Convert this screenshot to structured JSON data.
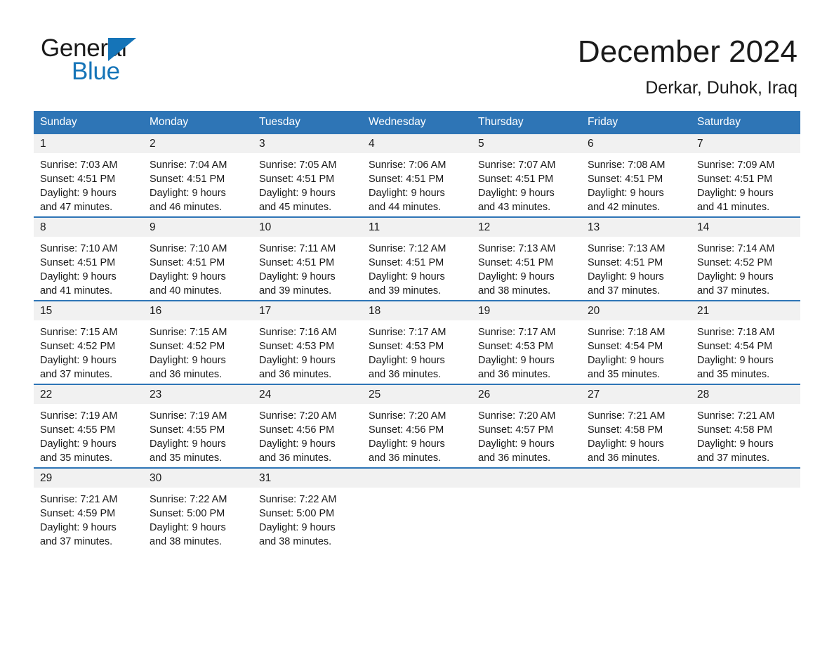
{
  "brand": {
    "name_part1": "General",
    "name_part2": "Blue",
    "logo_icon": "triangle-flag-icon",
    "color_primary": "#1574b8"
  },
  "header": {
    "month_title": "December 2024",
    "location": "Derkar, Duhok, Iraq"
  },
  "calendar": {
    "accent_color": "#2e75b6",
    "daynum_bg": "#f1f1f1",
    "weekday_headers": [
      "Sunday",
      "Monday",
      "Tuesday",
      "Wednesday",
      "Thursday",
      "Friday",
      "Saturday"
    ],
    "weeks": [
      [
        {
          "day": "1",
          "sunrise": "Sunrise: 7:03 AM",
          "sunset": "Sunset: 4:51 PM",
          "daylight_line1": "Daylight: 9 hours",
          "daylight_line2": "and 47 minutes."
        },
        {
          "day": "2",
          "sunrise": "Sunrise: 7:04 AM",
          "sunset": "Sunset: 4:51 PM",
          "daylight_line1": "Daylight: 9 hours",
          "daylight_line2": "and 46 minutes."
        },
        {
          "day": "3",
          "sunrise": "Sunrise: 7:05 AM",
          "sunset": "Sunset: 4:51 PM",
          "daylight_line1": "Daylight: 9 hours",
          "daylight_line2": "and 45 minutes."
        },
        {
          "day": "4",
          "sunrise": "Sunrise: 7:06 AM",
          "sunset": "Sunset: 4:51 PM",
          "daylight_line1": "Daylight: 9 hours",
          "daylight_line2": "and 44 minutes."
        },
        {
          "day": "5",
          "sunrise": "Sunrise: 7:07 AM",
          "sunset": "Sunset: 4:51 PM",
          "daylight_line1": "Daylight: 9 hours",
          "daylight_line2": "and 43 minutes."
        },
        {
          "day": "6",
          "sunrise": "Sunrise: 7:08 AM",
          "sunset": "Sunset: 4:51 PM",
          "daylight_line1": "Daylight: 9 hours",
          "daylight_line2": "and 42 minutes."
        },
        {
          "day": "7",
          "sunrise": "Sunrise: 7:09 AM",
          "sunset": "Sunset: 4:51 PM",
          "daylight_line1": "Daylight: 9 hours",
          "daylight_line2": "and 41 minutes."
        }
      ],
      [
        {
          "day": "8",
          "sunrise": "Sunrise: 7:10 AM",
          "sunset": "Sunset: 4:51 PM",
          "daylight_line1": "Daylight: 9 hours",
          "daylight_line2": "and 41 minutes."
        },
        {
          "day": "9",
          "sunrise": "Sunrise: 7:10 AM",
          "sunset": "Sunset: 4:51 PM",
          "daylight_line1": "Daylight: 9 hours",
          "daylight_line2": "and 40 minutes."
        },
        {
          "day": "10",
          "sunrise": "Sunrise: 7:11 AM",
          "sunset": "Sunset: 4:51 PM",
          "daylight_line1": "Daylight: 9 hours",
          "daylight_line2": "and 39 minutes."
        },
        {
          "day": "11",
          "sunrise": "Sunrise: 7:12 AM",
          "sunset": "Sunset: 4:51 PM",
          "daylight_line1": "Daylight: 9 hours",
          "daylight_line2": "and 39 minutes."
        },
        {
          "day": "12",
          "sunrise": "Sunrise: 7:13 AM",
          "sunset": "Sunset: 4:51 PM",
          "daylight_line1": "Daylight: 9 hours",
          "daylight_line2": "and 38 minutes."
        },
        {
          "day": "13",
          "sunrise": "Sunrise: 7:13 AM",
          "sunset": "Sunset: 4:51 PM",
          "daylight_line1": "Daylight: 9 hours",
          "daylight_line2": "and 37 minutes."
        },
        {
          "day": "14",
          "sunrise": "Sunrise: 7:14 AM",
          "sunset": "Sunset: 4:52 PM",
          "daylight_line1": "Daylight: 9 hours",
          "daylight_line2": "and 37 minutes."
        }
      ],
      [
        {
          "day": "15",
          "sunrise": "Sunrise: 7:15 AM",
          "sunset": "Sunset: 4:52 PM",
          "daylight_line1": "Daylight: 9 hours",
          "daylight_line2": "and 37 minutes."
        },
        {
          "day": "16",
          "sunrise": "Sunrise: 7:15 AM",
          "sunset": "Sunset: 4:52 PM",
          "daylight_line1": "Daylight: 9 hours",
          "daylight_line2": "and 36 minutes."
        },
        {
          "day": "17",
          "sunrise": "Sunrise: 7:16 AM",
          "sunset": "Sunset: 4:53 PM",
          "daylight_line1": "Daylight: 9 hours",
          "daylight_line2": "and 36 minutes."
        },
        {
          "day": "18",
          "sunrise": "Sunrise: 7:17 AM",
          "sunset": "Sunset: 4:53 PM",
          "daylight_line1": "Daylight: 9 hours",
          "daylight_line2": "and 36 minutes."
        },
        {
          "day": "19",
          "sunrise": "Sunrise: 7:17 AM",
          "sunset": "Sunset: 4:53 PM",
          "daylight_line1": "Daylight: 9 hours",
          "daylight_line2": "and 36 minutes."
        },
        {
          "day": "20",
          "sunrise": "Sunrise: 7:18 AM",
          "sunset": "Sunset: 4:54 PM",
          "daylight_line1": "Daylight: 9 hours",
          "daylight_line2": "and 35 minutes."
        },
        {
          "day": "21",
          "sunrise": "Sunrise: 7:18 AM",
          "sunset": "Sunset: 4:54 PM",
          "daylight_line1": "Daylight: 9 hours",
          "daylight_line2": "and 35 minutes."
        }
      ],
      [
        {
          "day": "22",
          "sunrise": "Sunrise: 7:19 AM",
          "sunset": "Sunset: 4:55 PM",
          "daylight_line1": "Daylight: 9 hours",
          "daylight_line2": "and 35 minutes."
        },
        {
          "day": "23",
          "sunrise": "Sunrise: 7:19 AM",
          "sunset": "Sunset: 4:55 PM",
          "daylight_line1": "Daylight: 9 hours",
          "daylight_line2": "and 35 minutes."
        },
        {
          "day": "24",
          "sunrise": "Sunrise: 7:20 AM",
          "sunset": "Sunset: 4:56 PM",
          "daylight_line1": "Daylight: 9 hours",
          "daylight_line2": "and 36 minutes."
        },
        {
          "day": "25",
          "sunrise": "Sunrise: 7:20 AM",
          "sunset": "Sunset: 4:56 PM",
          "daylight_line1": "Daylight: 9 hours",
          "daylight_line2": "and 36 minutes."
        },
        {
          "day": "26",
          "sunrise": "Sunrise: 7:20 AM",
          "sunset": "Sunset: 4:57 PM",
          "daylight_line1": "Daylight: 9 hours",
          "daylight_line2": "and 36 minutes."
        },
        {
          "day": "27",
          "sunrise": "Sunrise: 7:21 AM",
          "sunset": "Sunset: 4:58 PM",
          "daylight_line1": "Daylight: 9 hours",
          "daylight_line2": "and 36 minutes."
        },
        {
          "day": "28",
          "sunrise": "Sunrise: 7:21 AM",
          "sunset": "Sunset: 4:58 PM",
          "daylight_line1": "Daylight: 9 hours",
          "daylight_line2": "and 37 minutes."
        }
      ],
      [
        {
          "day": "29",
          "sunrise": "Sunrise: 7:21 AM",
          "sunset": "Sunset: 4:59 PM",
          "daylight_line1": "Daylight: 9 hours",
          "daylight_line2": "and 37 minutes."
        },
        {
          "day": "30",
          "sunrise": "Sunrise: 7:22 AM",
          "sunset": "Sunset: 5:00 PM",
          "daylight_line1": "Daylight: 9 hours",
          "daylight_line2": "and 38 minutes."
        },
        {
          "day": "31",
          "sunrise": "Sunrise: 7:22 AM",
          "sunset": "Sunset: 5:00 PM",
          "daylight_line1": "Daylight: 9 hours",
          "daylight_line2": "and 38 minutes."
        },
        {
          "day": "",
          "sunrise": "",
          "sunset": "",
          "daylight_line1": "",
          "daylight_line2": ""
        },
        {
          "day": "",
          "sunrise": "",
          "sunset": "",
          "daylight_line1": "",
          "daylight_line2": ""
        },
        {
          "day": "",
          "sunrise": "",
          "sunset": "",
          "daylight_line1": "",
          "daylight_line2": ""
        },
        {
          "day": "",
          "sunrise": "",
          "sunset": "",
          "daylight_line1": "",
          "daylight_line2": ""
        }
      ]
    ]
  }
}
